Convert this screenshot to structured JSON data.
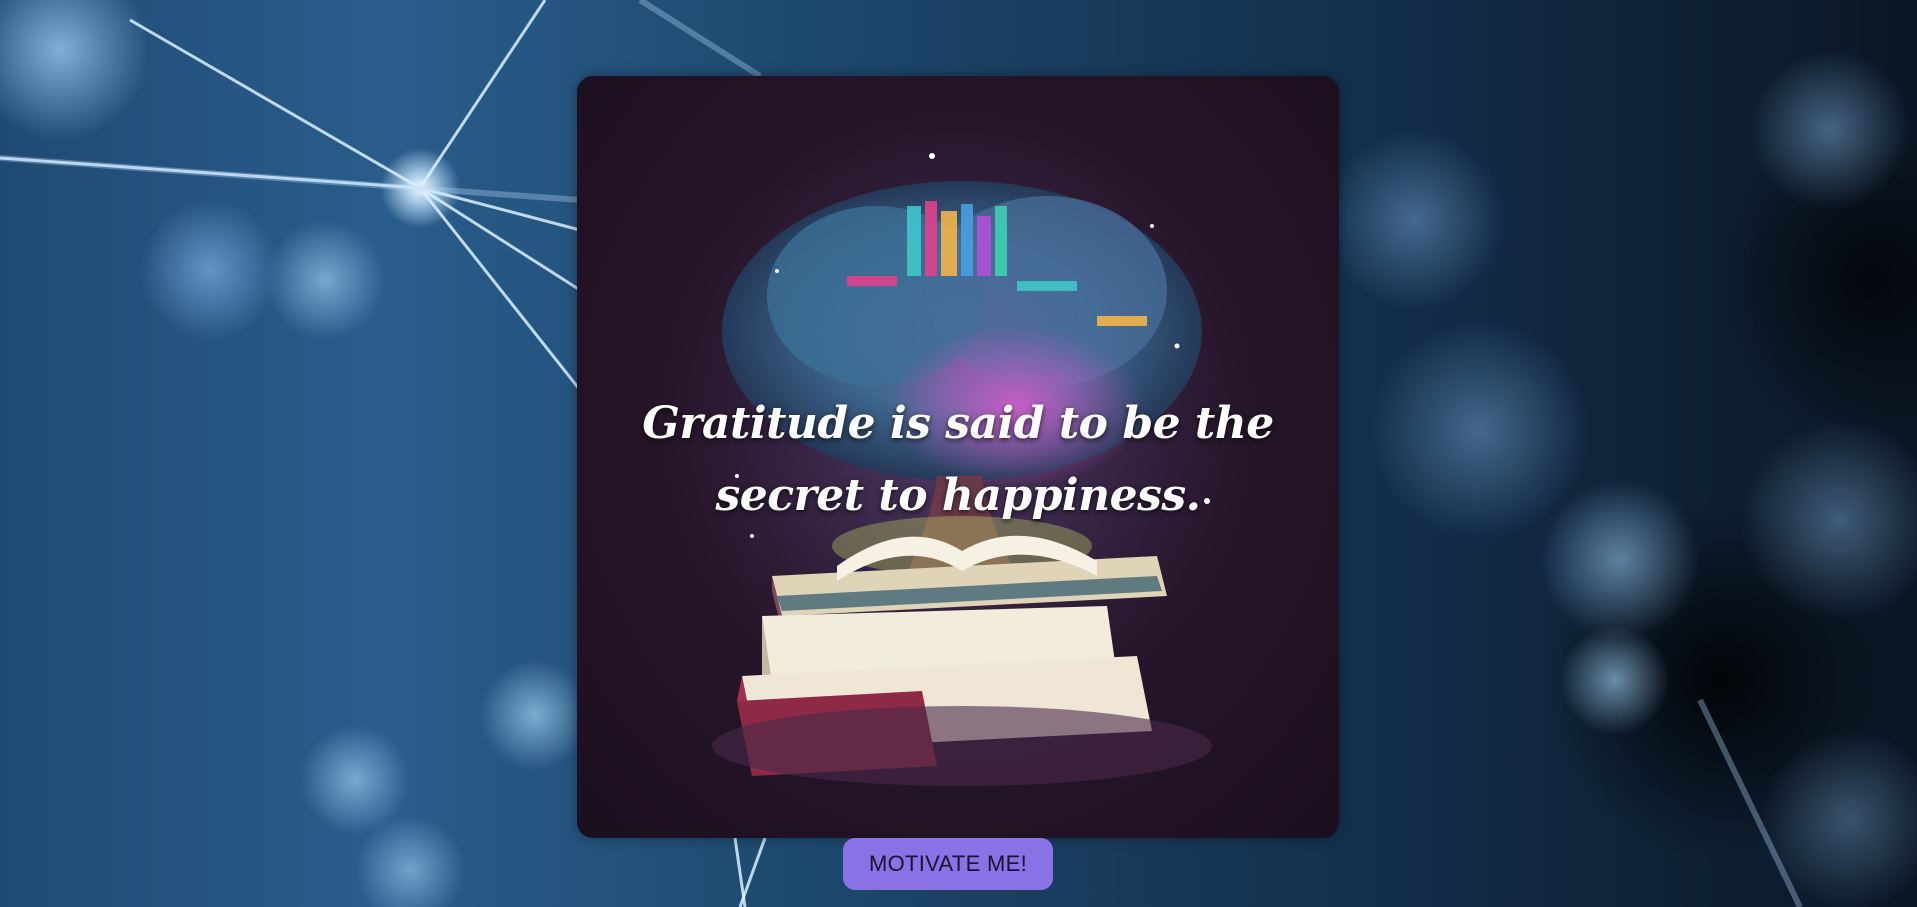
{
  "quote_card": {
    "quote_text": "Gratitude is said to be the secret to happiness.",
    "illustration_icon": "books-tree-brain-illustration"
  },
  "actions": {
    "motivate_label": "MOTIVATE ME!"
  },
  "colors": {
    "button_bg": "#8a71e6",
    "card_bg": "#261529",
    "quote_text": "#ffffff"
  }
}
